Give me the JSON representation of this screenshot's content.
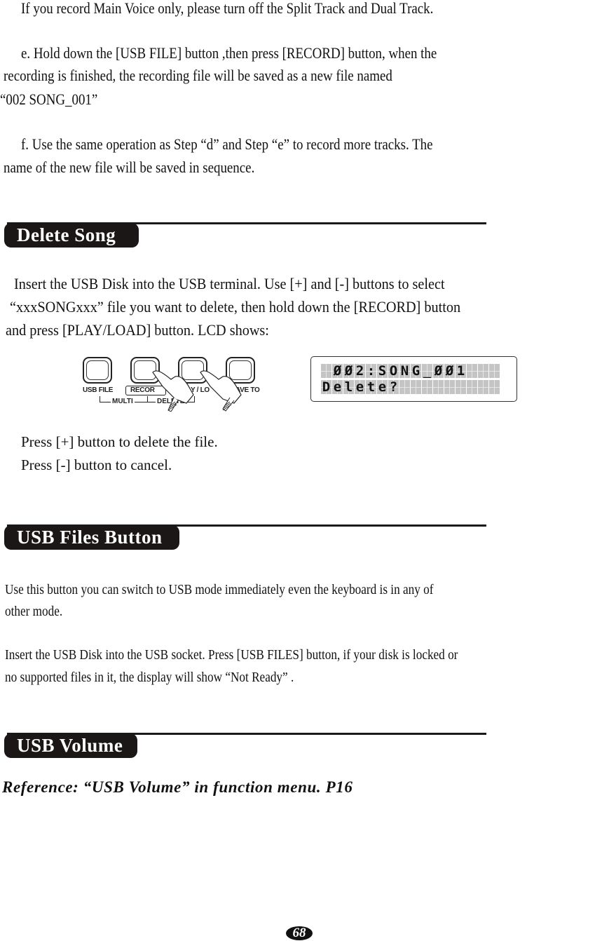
{
  "intro": {
    "line1": "If you record Main Voice only, please turn off the Split Track and Dual Track.",
    "step_e": [
      "e. Hold down the [USB FILE] button ,then press [RECORD] button, when the",
      "recording is finished, the recording file will be saved as a new file named",
      "“002 SONG_001”"
    ],
    "step_f": [
      "f. Use the same operation as Step  “d”   and Step  “e”  to record more tracks. The",
      "name of the new file will be saved in sequence."
    ]
  },
  "sections": {
    "delete_song": {
      "title": "Delete Song",
      "body": [
        "Insert the USB Disk into the USB terminal. Use [+] and [-] buttons to select",
        "“xxxSONGxxx”   file you want to delete, then hold down the [RECORD] button",
        "and press [PLAY/LOAD] button. LCD shows:"
      ],
      "panel": {
        "buttons": [
          "USB FILE",
          "RECORD",
          "PLAY / LOAD",
          "SAVE TO"
        ],
        "visible_labels": [
          "USB FILE",
          "RECOR",
          "AY / LO",
          "AVE TO"
        ],
        "brackets": [
          "MULTI",
          "DELETE"
        ]
      },
      "lcd": {
        "line1": " 002:SONG_001",
        "line2": "Delete?",
        "columns": 16
      },
      "after": [
        "Press [+] button to delete the file.",
        "Press [-] button to cancel."
      ]
    },
    "usb_files_button": {
      "title": "USB Files Button",
      "body": [
        "Use this button you can switch to USB mode immediately even the keyboard is in any of",
        "other mode.",
        "Insert the USB Disk into the USB socket. Press [USB FILES] button, if your disk is  locked or",
        "no supported files in it, the display will show  “Not Ready” ."
      ]
    },
    "usb_volume": {
      "title": "USB Volume",
      "reference": "Reference:  “USB Volume”  in function menu. P16"
    }
  },
  "page_number": "68"
}
